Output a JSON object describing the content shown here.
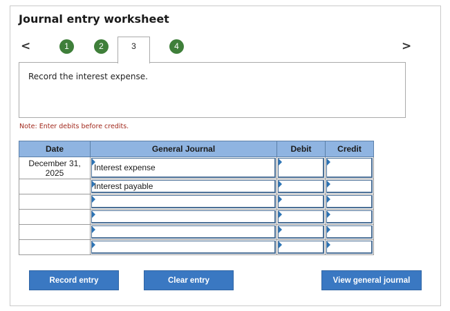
{
  "title": "Journal entry worksheet",
  "nav": {
    "prev_glyph": "<",
    "next_glyph": ">",
    "steps": [
      {
        "label": "1",
        "state": "complete"
      },
      {
        "label": "2",
        "state": "complete"
      },
      {
        "label": "3",
        "state": "active"
      },
      {
        "label": "4",
        "state": "complete"
      }
    ]
  },
  "instruction": "Record the interest expense.",
  "note": "Note: Enter debits before credits.",
  "table": {
    "headers": {
      "date": "Date",
      "journal": "General Journal",
      "debit": "Debit",
      "credit": "Credit"
    },
    "rows": [
      {
        "date_line1": "December 31,",
        "date_line2": "2025",
        "account": "Interest expense",
        "debit": "",
        "credit": ""
      },
      {
        "date_line1": "",
        "date_line2": "",
        "account": "Interest payable",
        "debit": "",
        "credit": ""
      },
      {
        "date_line1": "",
        "date_line2": "",
        "account": "",
        "debit": "",
        "credit": ""
      },
      {
        "date_line1": "",
        "date_line2": "",
        "account": "",
        "debit": "",
        "credit": ""
      },
      {
        "date_line1": "",
        "date_line2": "",
        "account": "",
        "debit": "",
        "credit": ""
      },
      {
        "date_line1": "",
        "date_line2": "",
        "account": "",
        "debit": "",
        "credit": ""
      }
    ]
  },
  "buttons": {
    "record": "Record entry",
    "clear": "Clear entry",
    "view": "View general journal"
  },
  "colors": {
    "step_complete": "#3f7f3a",
    "header_bg": "#8fb4e1",
    "button_bg": "#3a78c2",
    "note_text": "#a1281c"
  }
}
